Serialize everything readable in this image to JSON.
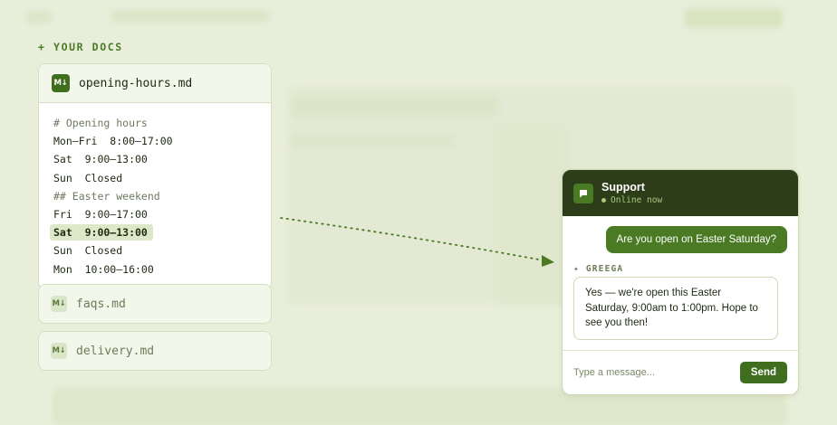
{
  "section_label": "+ YOUR DOCS",
  "docs": {
    "open": {
      "badge": "M↓",
      "name": "opening-hours.md",
      "lines": [
        "# Opening hours",
        "Mon–Fri  8:00–17:00",
        "Sat  9:00–13:00",
        "Sun  Closed",
        "## Easter weekend",
        "Fri  9:00–17:00",
        "Sat  9:00–13:00",
        "Sun  Closed",
        "Mon  10:00–16:00"
      ]
    },
    "closed": [
      {
        "badge": "M↓",
        "name": "faqs.md"
      },
      {
        "badge": "M↓",
        "name": "delivery.md"
      }
    ]
  },
  "chat": {
    "title": "Support",
    "status": "Online now",
    "user_message": "Are you open on Easter Saturday?",
    "bot_label": "✦ GREEGA",
    "bot_message": "Yes — we're open this Easter Saturday, 9:00am to 1:00pm. Hope to see you then!",
    "input_placeholder": "Type a message...",
    "send_label": "Send"
  },
  "colors": {
    "accent": "#4a7a23",
    "header_dark": "#2d3d1a",
    "background": "#e9eeda"
  }
}
